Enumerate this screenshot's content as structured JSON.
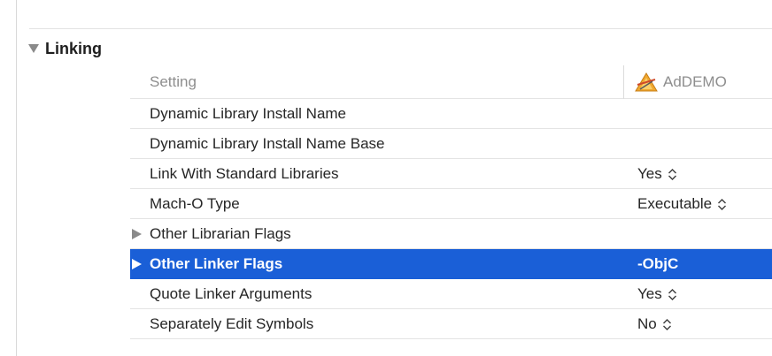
{
  "section": {
    "title": "Linking",
    "expanded": true
  },
  "table": {
    "header_setting": "Setting",
    "header_target": "AdDEMO",
    "target_icon": "xcode-app-icon",
    "rows": [
      {
        "name": "Dynamic Library Install Name",
        "value": "",
        "expandable": false,
        "stepper": false,
        "selected": false
      },
      {
        "name": "Dynamic Library Install Name Base",
        "value": "",
        "expandable": false,
        "stepper": false,
        "selected": false
      },
      {
        "name": "Link With Standard Libraries",
        "value": "Yes",
        "expandable": false,
        "stepper": true,
        "selected": false
      },
      {
        "name": "Mach-O Type",
        "value": "Executable",
        "expandable": false,
        "stepper": true,
        "selected": false
      },
      {
        "name": "Other Librarian Flags",
        "value": "",
        "expandable": true,
        "stepper": false,
        "selected": false
      },
      {
        "name": "Other Linker Flags",
        "value": "-ObjC",
        "expandable": true,
        "stepper": false,
        "selected": true
      },
      {
        "name": "Quote Linker Arguments",
        "value": "Yes",
        "expandable": false,
        "stepper": true,
        "selected": false
      },
      {
        "name": "Separately Edit Symbols",
        "value": "No",
        "expandable": false,
        "stepper": true,
        "selected": false
      }
    ]
  },
  "colors": {
    "selection": "#1a5fd7",
    "header_text": "#8e8e8e"
  }
}
